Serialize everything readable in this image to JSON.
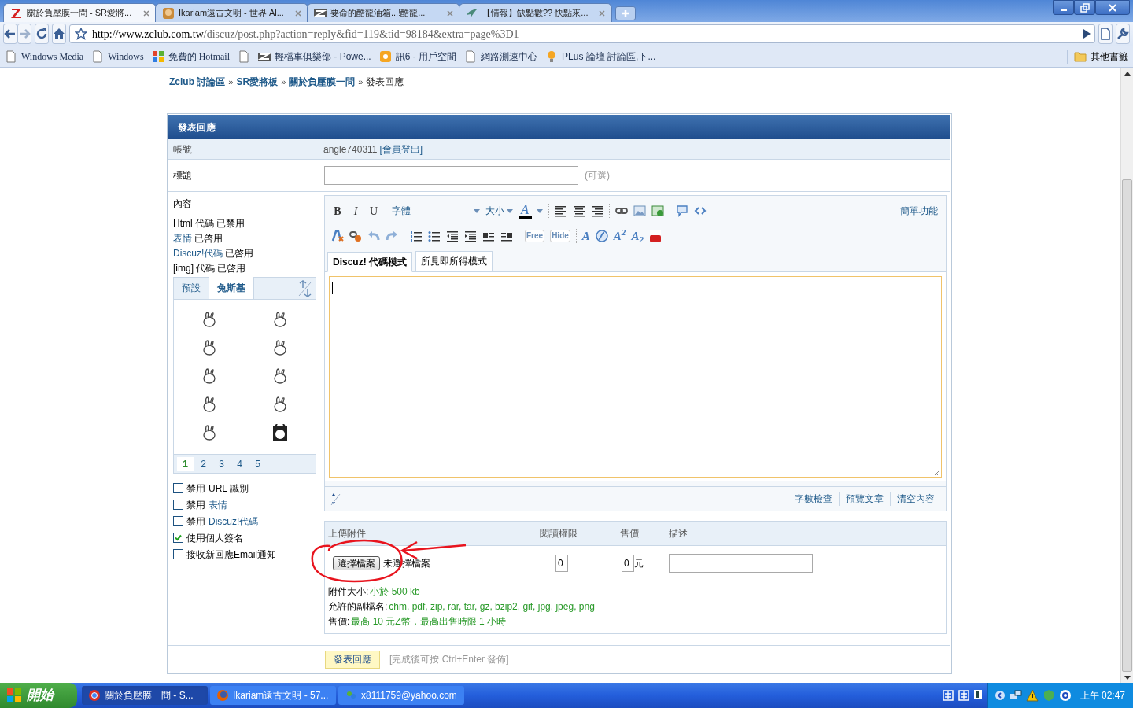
{
  "browser": {
    "tabs": [
      {
        "title": "關於負壓膜一問 - SR愛將...",
        "selected": true
      },
      {
        "title": "Ikariam遠古文明 - 世界 Al...",
        "selected": false
      },
      {
        "title": "要命的酷龍油箱...!酷龍...",
        "selected": false
      },
      {
        "title": "【情報】缺點數?? 快點來...",
        "selected": false
      }
    ],
    "url_host": "http://www.zclub.com.tw",
    "url_path": "/discuz/post.php?action=reply&fid=119&tid=98184&extra=page%3D1",
    "bookmarks": [
      "Windows Media",
      "Windows",
      "免費的 Hotmail",
      "輕檔車俱樂部 - Powe...",
      "訊6 - 用戶空間",
      "網路測速中心",
      "PLus 論壇 討論區,下..."
    ],
    "other_bookmarks": "其他書籤"
  },
  "breadcrumb": [
    {
      "label": "Zclub 討論區",
      "kind": "link"
    },
    {
      "label": "SR愛將板",
      "kind": "link"
    },
    {
      "label": "關於負壓膜一問",
      "kind": "link"
    },
    {
      "label": "發表回應",
      "kind": "current"
    }
  ],
  "breadcrumb_separator": "»",
  "form": {
    "title": "發表回應",
    "account": {
      "label": "帳號",
      "user": "angle740311",
      "logout": "[會員登出]"
    },
    "subject": {
      "label": "標題",
      "hint": "(可選)"
    },
    "content": {
      "label": "內容",
      "rules": [
        {
          "name": "Html 代碼",
          "status": "已禁用",
          "link": false
        },
        {
          "name": "表情",
          "status": "已啓用",
          "link": true
        },
        {
          "name": "Discuz!代碼",
          "status": "已啓用",
          "link": true
        },
        {
          "name": "[img] 代碼",
          "status": "已啓用",
          "link": false
        }
      ]
    },
    "smilies": {
      "tabs": [
        {
          "label": "預設",
          "selected": false
        },
        {
          "label": "兔斯基",
          "selected": true
        }
      ],
      "pages": [
        {
          "label": "1",
          "selected": true
        },
        {
          "label": "2",
          "selected": false
        },
        {
          "label": "3",
          "selected": false
        },
        {
          "label": "4",
          "selected": false
        },
        {
          "label": "5",
          "selected": false
        }
      ]
    },
    "options": [
      {
        "prefix": "禁用",
        "label": "URL 識別",
        "link": false,
        "checked": false
      },
      {
        "prefix": "禁用",
        "label": "表情",
        "link": true,
        "checked": false
      },
      {
        "prefix": "禁用",
        "label": "Discuz!代碼",
        "link": true,
        "checked": false
      },
      {
        "label": "使用個人簽名",
        "link": false,
        "checked": true
      },
      {
        "label": "接收新回應Email通知",
        "link": false,
        "checked": false
      }
    ]
  },
  "editor": {
    "toolbar_rows": [
      [
        {
          "kind": "bold",
          "text": "B"
        },
        {
          "kind": "italic",
          "text": "I"
        },
        {
          "kind": "underline",
          "text": "U"
        },
        {
          "kind": "sep"
        },
        {
          "kind": "font",
          "text": "字體"
        },
        {
          "kind": "size",
          "text": "大小"
        },
        {
          "kind": "color",
          "text": "A"
        },
        {
          "kind": "sep"
        },
        {
          "kind": "align-left"
        },
        {
          "kind": "align-center"
        },
        {
          "kind": "align-right"
        },
        {
          "kind": "sep"
        },
        {
          "kind": "link"
        },
        {
          "kind": "image"
        },
        {
          "kind": "media"
        },
        {
          "kind": "sep"
        },
        {
          "kind": "quote"
        },
        {
          "kind": "code"
        }
      ],
      [
        {
          "kind": "clear"
        },
        {
          "kind": "unlink"
        },
        {
          "kind": "undo"
        },
        {
          "kind": "redo"
        },
        {
          "kind": "sep"
        },
        {
          "kind": "ordered-list"
        },
        {
          "kind": "bullet-list"
        },
        {
          "kind": "outdent"
        },
        {
          "kind": "indent"
        },
        {
          "kind": "float-left"
        },
        {
          "kind": "float-right"
        },
        {
          "kind": "sep"
        },
        {
          "kind": "tag",
          "text": "Free"
        },
        {
          "kind": "tag",
          "text": "Hide"
        },
        {
          "kind": "sep"
        },
        {
          "kind": "glyph",
          "text": "A"
        },
        {
          "kind": "flash"
        },
        {
          "kind": "glyph",
          "text": "A$^{2}$"
        },
        {
          "kind": "glyph",
          "text": "A$_{2}$"
        },
        {
          "kind": "video"
        }
      ]
    ],
    "simple_mode": "簡單功能",
    "modes": [
      {
        "label": "Discuz! 代碼模式",
        "selected": true
      },
      {
        "label": "所見即所得模式",
        "selected": false
      }
    ],
    "actions": [
      "字數檢查",
      "預覽文章",
      "清空內容"
    ]
  },
  "attachments": {
    "columns": [
      "上傳附件",
      "閱讀權限",
      "售價",
      "描述"
    ],
    "file_button": "選擇檔案",
    "file_status": "未選擇檔案",
    "permission": "0",
    "price": "0",
    "currency": "元",
    "notes": [
      {
        "label": "附件大小:",
        "value": "小於 500 kb"
      },
      {
        "label": "允許的副檔名:",
        "value": "chm, pdf, zip, rar, tar, gz, bzip2, gif, jpg, jpeg, png"
      },
      {
        "label": "售價:",
        "value": "最高 10 元Z幣，最高出售時限 1 小時"
      }
    ]
  },
  "submit": {
    "label": "發表回應",
    "hint": "[完成後可按 Ctrl+Enter 發佈]"
  },
  "taskbar": {
    "start": "開始",
    "tasks": [
      {
        "label": "關於負壓膜一問 - S...",
        "selected": true
      },
      {
        "label": "Ikariam遠古文明 - 57...",
        "selected": false
      },
      {
        "label": "x8111759@yahoo.com",
        "selected": false
      }
    ],
    "clock": "上午 02:47"
  }
}
